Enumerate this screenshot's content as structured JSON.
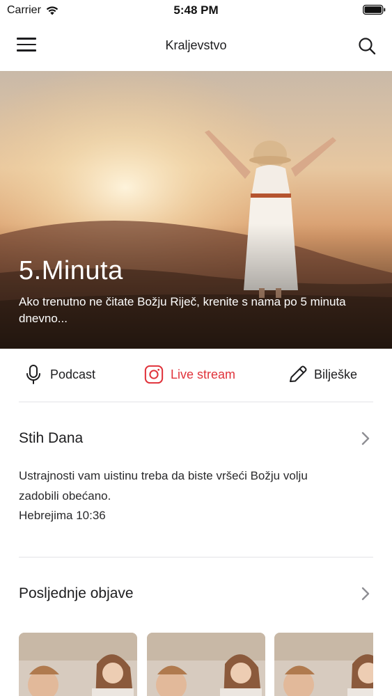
{
  "status_bar": {
    "carrier": "Carrier",
    "time": "5:48 PM",
    "icons": [
      "wifi-icon",
      "battery-icon"
    ]
  },
  "nav": {
    "title": "Kraljevstvo",
    "left_icon": "hamburger-menu-icon",
    "right_icon": "search-icon"
  },
  "hero": {
    "title": "5.Minuta",
    "description": "Ako trenutno ne čitate Božju Riječ, krenite s nama po 5 minuta dnevno..."
  },
  "actions": [
    {
      "label": "Podcast",
      "icon": "microphone-icon"
    },
    {
      "label": "Live stream",
      "icon": "instagram-icon",
      "color": "#e0333b"
    },
    {
      "label": "Bilješke",
      "icon": "pencil-icon"
    }
  ],
  "verse_of_day": {
    "title": "Stih Dana",
    "line1": "Ustrajnosti vam uistinu treba da biste vršeći Božju volju",
    "line2": "zadobili obećano.",
    "reference": "Hebrejima 10:36"
  },
  "latest_posts": {
    "title": "Posljednje objave",
    "cards": [
      "post-1",
      "post-2",
      "post-3"
    ]
  },
  "colors": {
    "accent": "#e0333b",
    "text": "#1d1d1f",
    "divider": "#e3e3e6",
    "chevron": "#8e8e93"
  }
}
